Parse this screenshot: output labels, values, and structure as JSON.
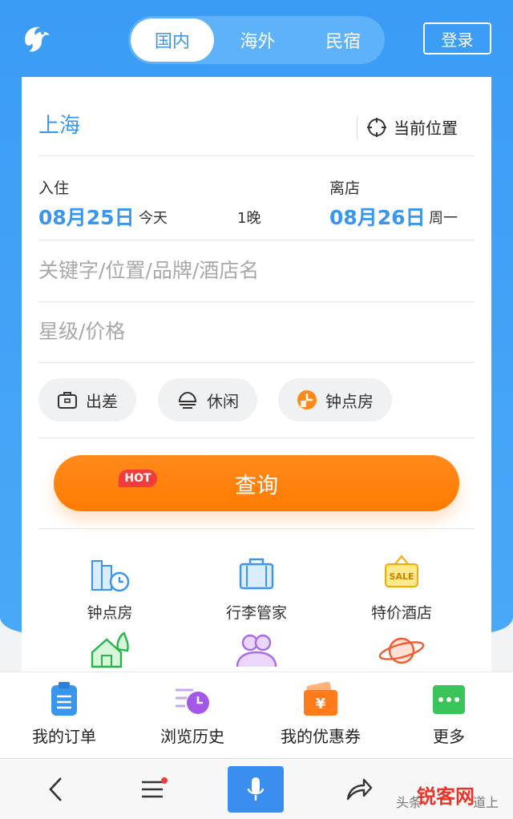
{
  "header": {
    "tabs": [
      {
        "label": "国内",
        "active": true
      },
      {
        "label": "海外",
        "active": false
      },
      {
        "label": "民宿",
        "active": false
      }
    ],
    "login_label": "登录"
  },
  "search_card": {
    "city": "上海",
    "current_location_label": "当前位置",
    "checkin": {
      "label": "入住",
      "date": "08月25日",
      "day": "今天"
    },
    "nights": "1晚",
    "checkout": {
      "label": "离店",
      "date": "08月26日",
      "day": "周一"
    },
    "keyword_placeholder": "关键字/位置/品牌/酒店名",
    "star_price_placeholder": "星级/价格",
    "chips": [
      {
        "label": "出差",
        "icon": "briefcase-icon"
      },
      {
        "label": "休闲",
        "icon": "leisure-icon"
      },
      {
        "label": "钟点房",
        "icon": "hourly-room-icon"
      }
    ],
    "search_label": "查询"
  },
  "features": [
    {
      "label": "钟点房",
      "icon": "hourly-building-icon",
      "badge": "HOT"
    },
    {
      "label": "行李管家",
      "icon": "luggage-icon"
    },
    {
      "label": "特价酒店",
      "icon": "sale-tag-icon",
      "icon_text": "SALE"
    },
    {
      "label": "",
      "icon": "house-icon"
    },
    {
      "label": "",
      "icon": "group-icon"
    },
    {
      "label": "",
      "icon": "planet-icon"
    }
  ],
  "quick_bar": [
    {
      "label": "我的订单",
      "icon": "order-icon"
    },
    {
      "label": "浏览历史",
      "icon": "history-icon"
    },
    {
      "label": "我的优惠券",
      "icon": "coupon-icon",
      "icon_text": "¥"
    },
    {
      "label": "更多",
      "icon": "more-icon"
    }
  ],
  "watermark": {
    "source": "头条",
    "brand": "锐客网",
    "suffix": "道上"
  },
  "colors": {
    "primary": "#3a96ec",
    "accent": "#ff7b00",
    "hot": "#f23c3c"
  }
}
